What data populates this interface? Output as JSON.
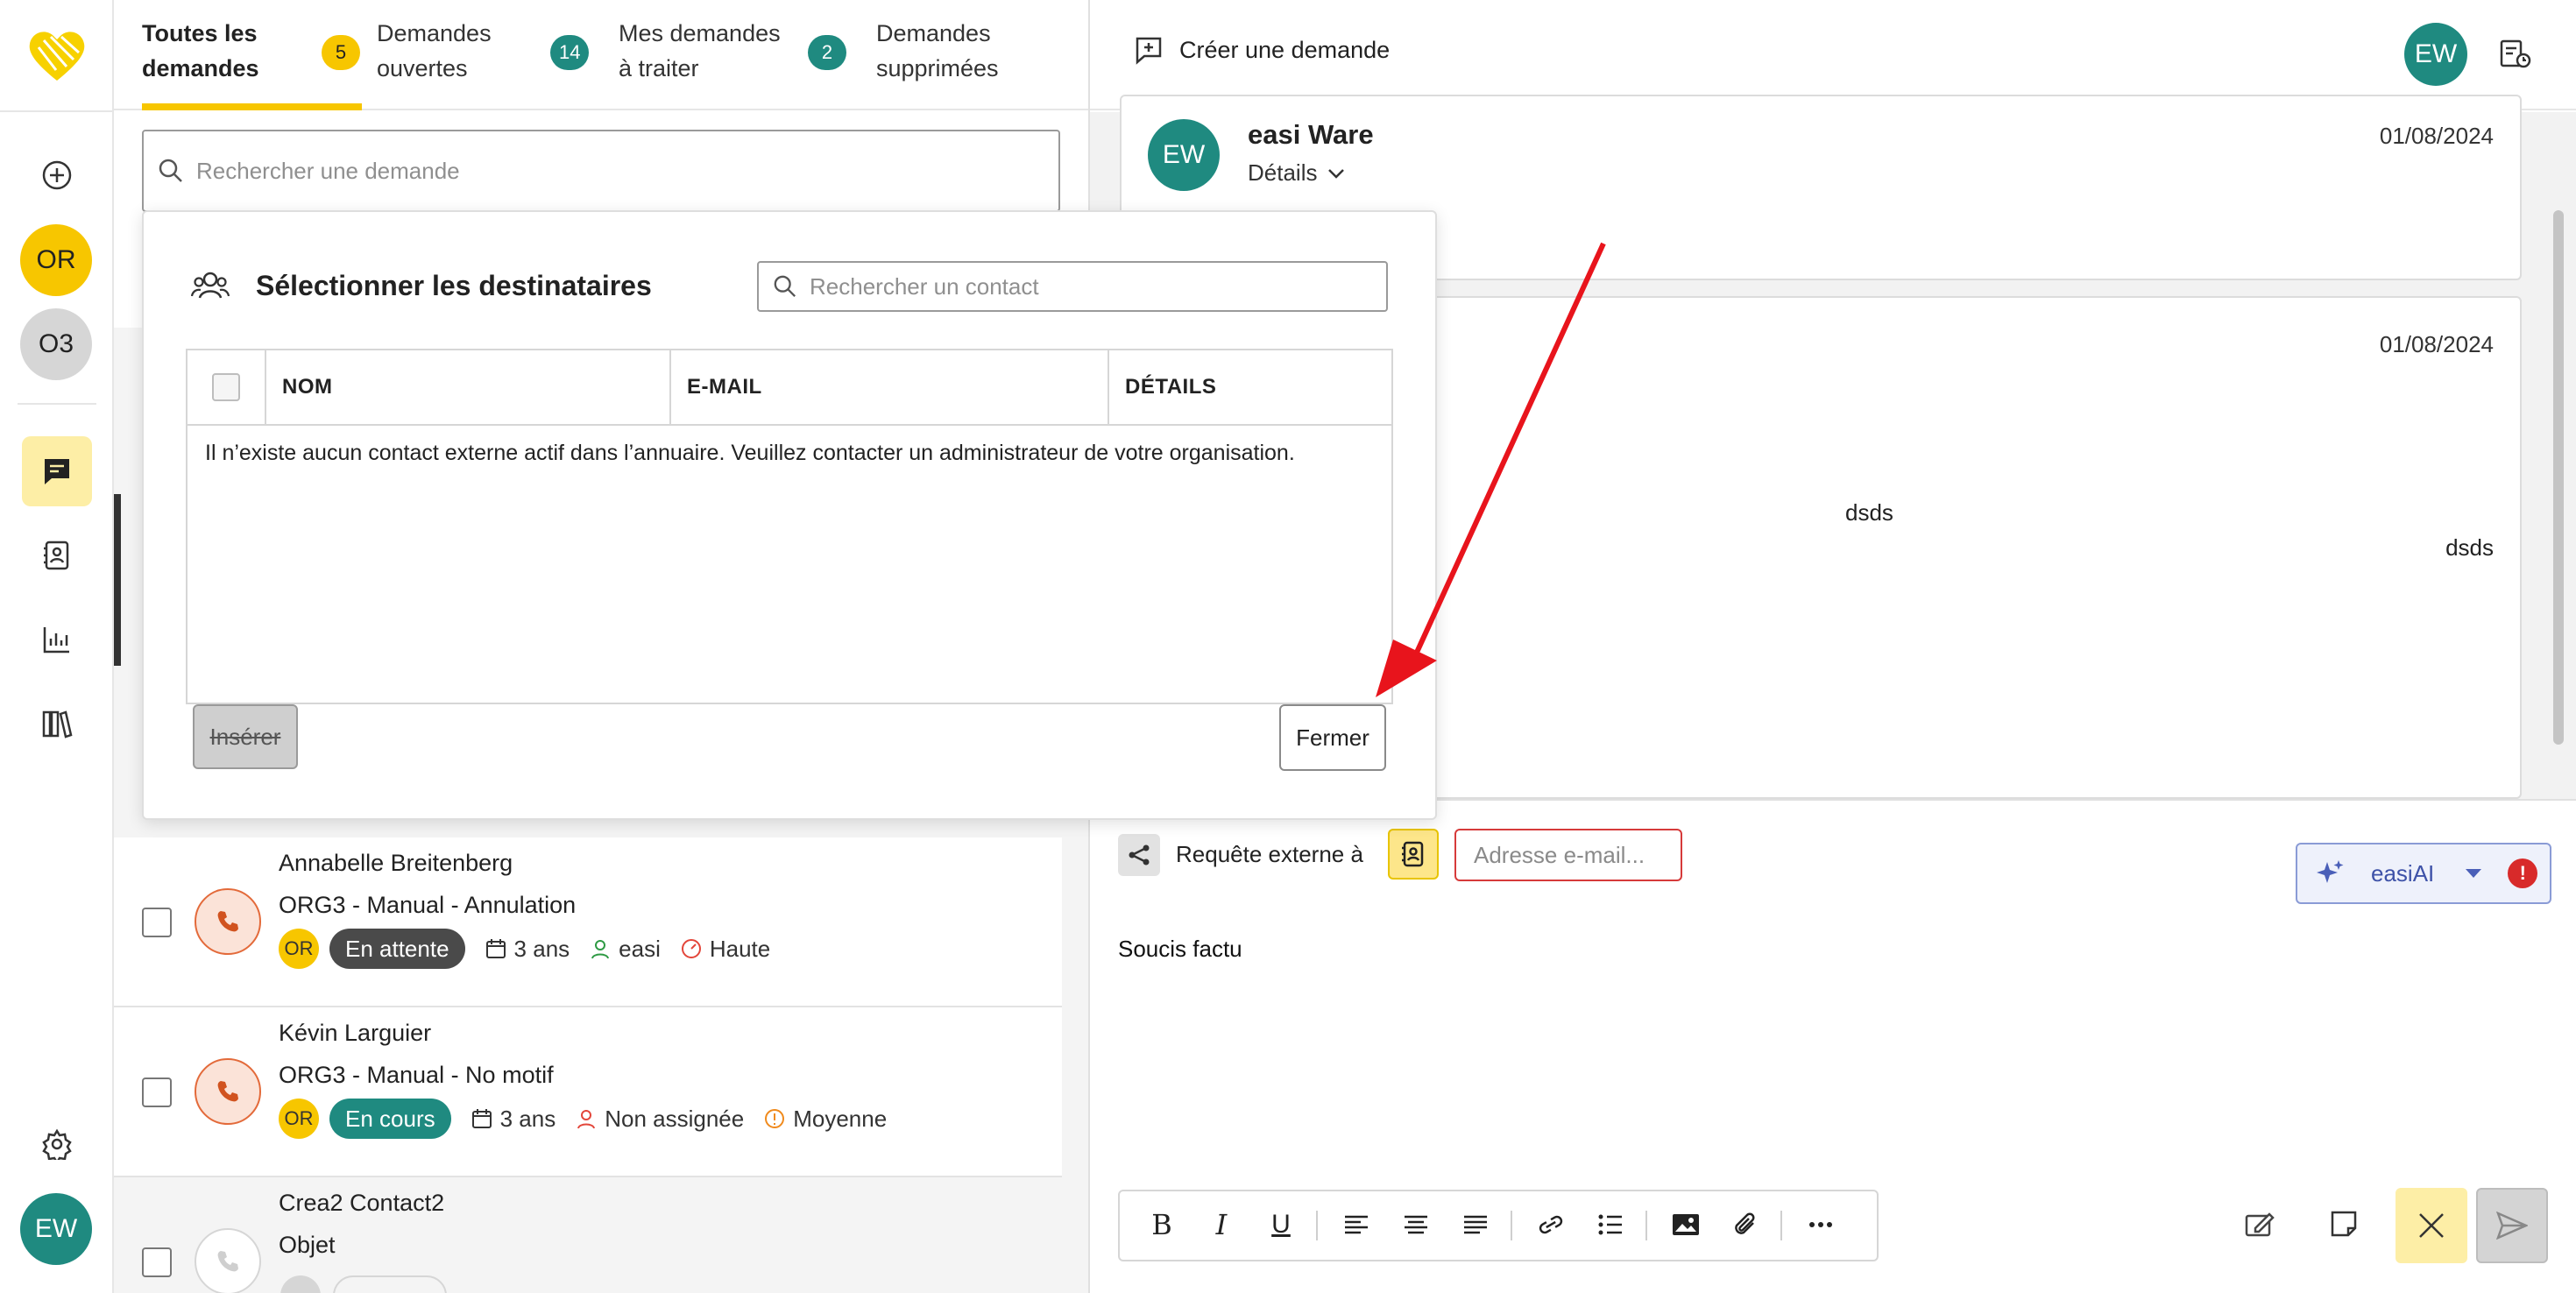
{
  "rail": {
    "avatars": [
      {
        "initials": "OR",
        "color": "#f7c600"
      },
      {
        "initials": "O3",
        "color": "#d6d6d6"
      }
    ],
    "user_initials": "EW",
    "colors": {
      "accent_yellow": "#f7c600",
      "active_bg": "#fdeea6",
      "teal": "#1f8a80"
    }
  },
  "tabs": [
    {
      "label_line1": "Toutes les",
      "label_line2": "demandes",
      "badge": "5",
      "active": true
    },
    {
      "label_line1": "Demandes",
      "label_line2": "ouvertes",
      "badge": "14"
    },
    {
      "label_line1": "Mes demandes",
      "label_line2": "à traiter",
      "badge": "2"
    },
    {
      "label_line1": "Demandes",
      "label_line2": "supprimées"
    }
  ],
  "list": {
    "search_placeholder": "Rechercher une demande",
    "rows": [
      {
        "name": "Annabelle Breitenberg",
        "subject": "ORG3 - Manual - Annulation",
        "org": "OR",
        "status": "En attente",
        "status_color": "#4a4a4a",
        "age": "3 ans",
        "assignee": "easi",
        "priority": "Haute"
      },
      {
        "name": "Kévin Larguier",
        "subject": "ORG3 - Manual - No motif",
        "org": "OR",
        "status": "En cours",
        "status_color": "#1f8a80",
        "age": "3 ans",
        "assignee": "Non assignée",
        "priority": "Moyenne"
      },
      {
        "name": "Crea2 Contact2",
        "subject": "Objet"
      }
    ]
  },
  "header_right": {
    "create_label": "Créer une demande",
    "user_initials": "EW"
  },
  "messages": [
    {
      "sender": "easi Ware",
      "initials": "EW",
      "details_label": "Détails",
      "date": "01/08/2024"
    },
    {
      "date": "01/08/2024",
      "body_line1": "dsds",
      "body_line2": "dsds"
    }
  ],
  "composer": {
    "external_label": "Requête externe à",
    "email_placeholder": "Adresse e-mail...",
    "ai_label": "easiAI",
    "body_text": "Soucis factu"
  },
  "modal": {
    "title": "Sélectionner les destinataires",
    "search_placeholder": "Rechercher un contact",
    "columns": [
      "NOM",
      "E-MAIL",
      "DÉTAILS"
    ],
    "empty_message": "Il n’existe aucun contact externe actif dans l’annuaire. Veuillez contacter un administrateur de votre organisation.",
    "insert_label": "Insérer",
    "close_label": "Fermer"
  }
}
